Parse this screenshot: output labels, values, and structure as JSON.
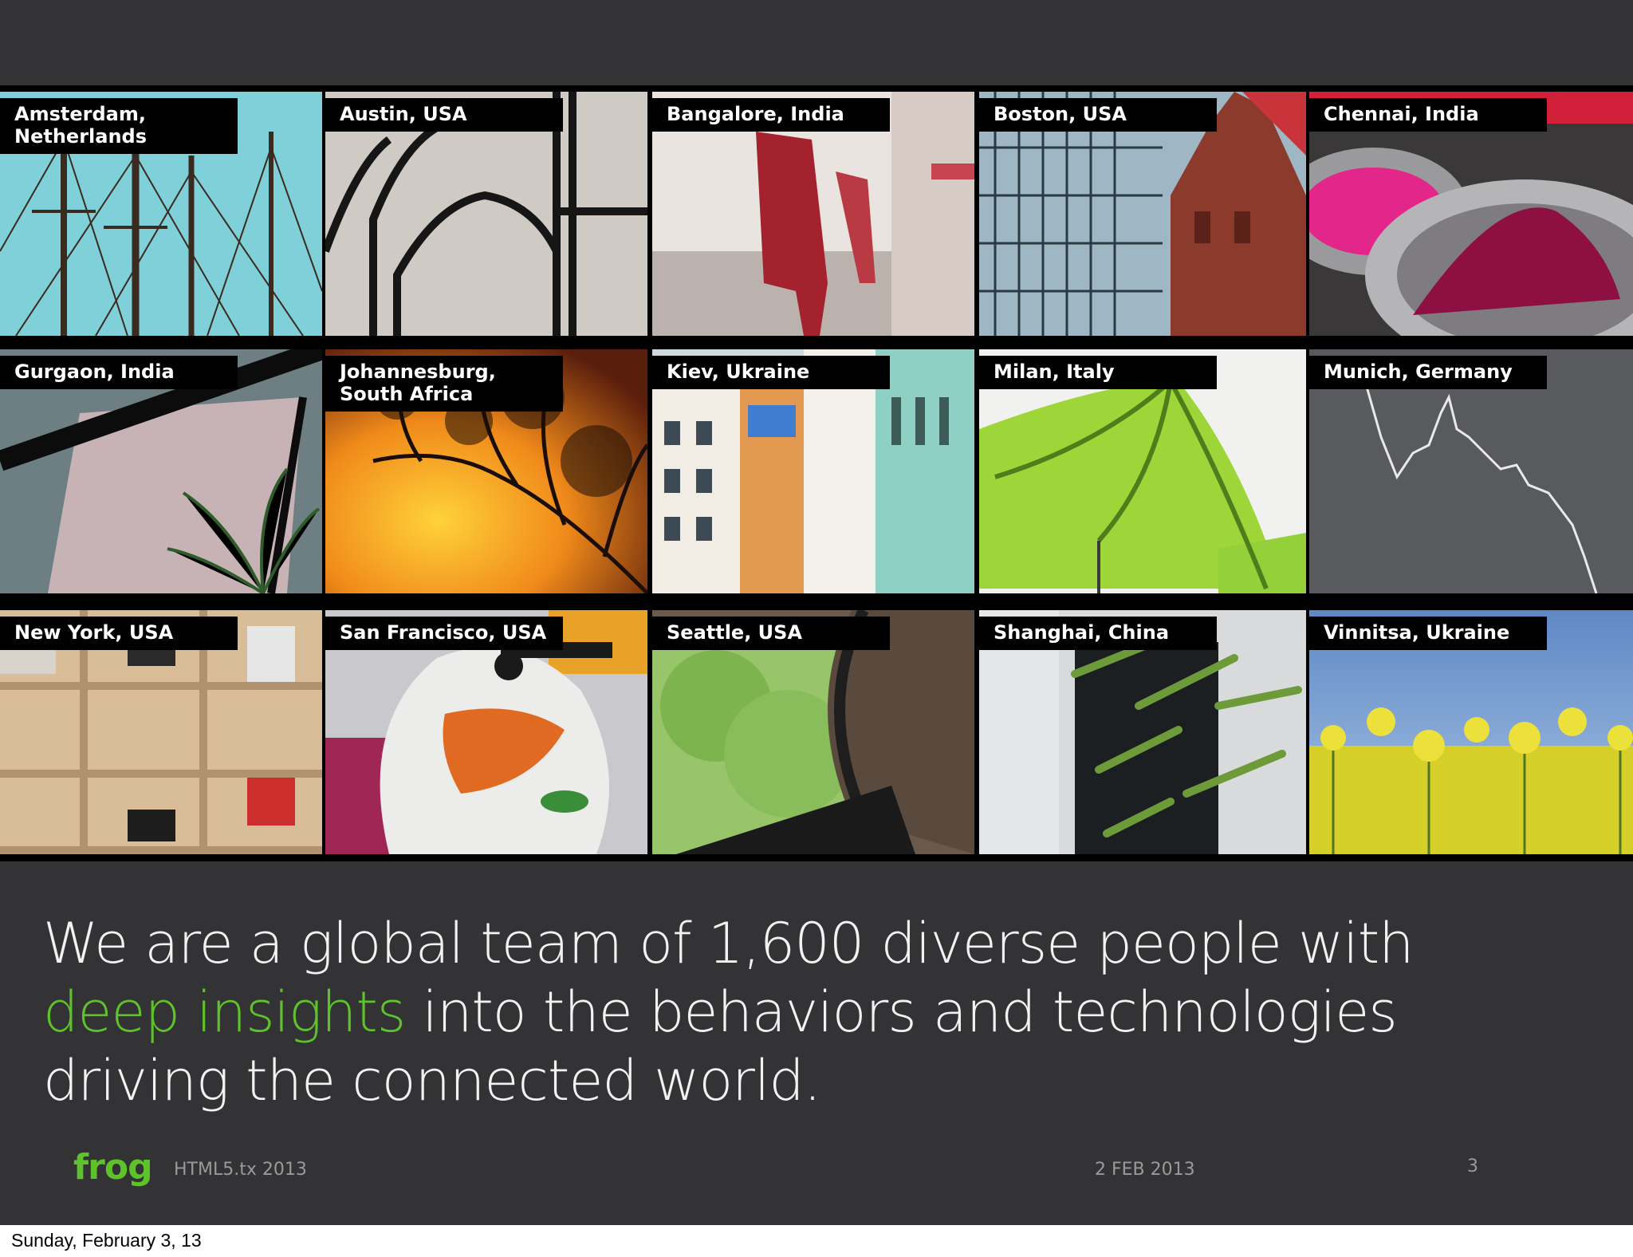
{
  "tiles": [
    {
      "label": "Amsterdam,\nNetherlands",
      "scene": "masts"
    },
    {
      "label": "Austin, USA",
      "scene": "window"
    },
    {
      "label": "Bangalore, India",
      "scene": "chairs"
    },
    {
      "label": "Boston, USA",
      "scene": "buildings"
    },
    {
      "label": "Chennai, India",
      "scene": "powder"
    },
    {
      "label": "Gurgaon, India",
      "scene": "atrium"
    },
    {
      "label": "Johannesburg,\nSouth Africa",
      "scene": "sunset"
    },
    {
      "label": "Kiev, Ukraine",
      "scene": "facades"
    },
    {
      "label": "Milan, Italy",
      "scene": "leaf"
    },
    {
      "label": "Munich, Germany",
      "scene": "graph"
    },
    {
      "label": "New York, USA",
      "scene": "shelves"
    },
    {
      "label": "San Francisco, USA",
      "scene": "motorcycle"
    },
    {
      "label": "Seattle, USA",
      "scene": "arch"
    },
    {
      "label": "Shanghai, China",
      "scene": "bamboo"
    },
    {
      "label": "Vinnitsa, Ukraine",
      "scene": "field"
    }
  ],
  "headline": {
    "part1": "We are a global team of 1,600 diverse people with ",
    "highlight": "deep insights",
    "part2": " into the behaviors and technologies driving the connected world."
  },
  "footer": {
    "logo": "frog",
    "event": "HTML5.tx 2013",
    "date": "2 FEB 2013",
    "page_number": "3"
  },
  "caption": "Sunday, February 3, 13",
  "colors": {
    "background": "#333235",
    "accent": "#5ec22b",
    "label_bg": "#000000"
  }
}
